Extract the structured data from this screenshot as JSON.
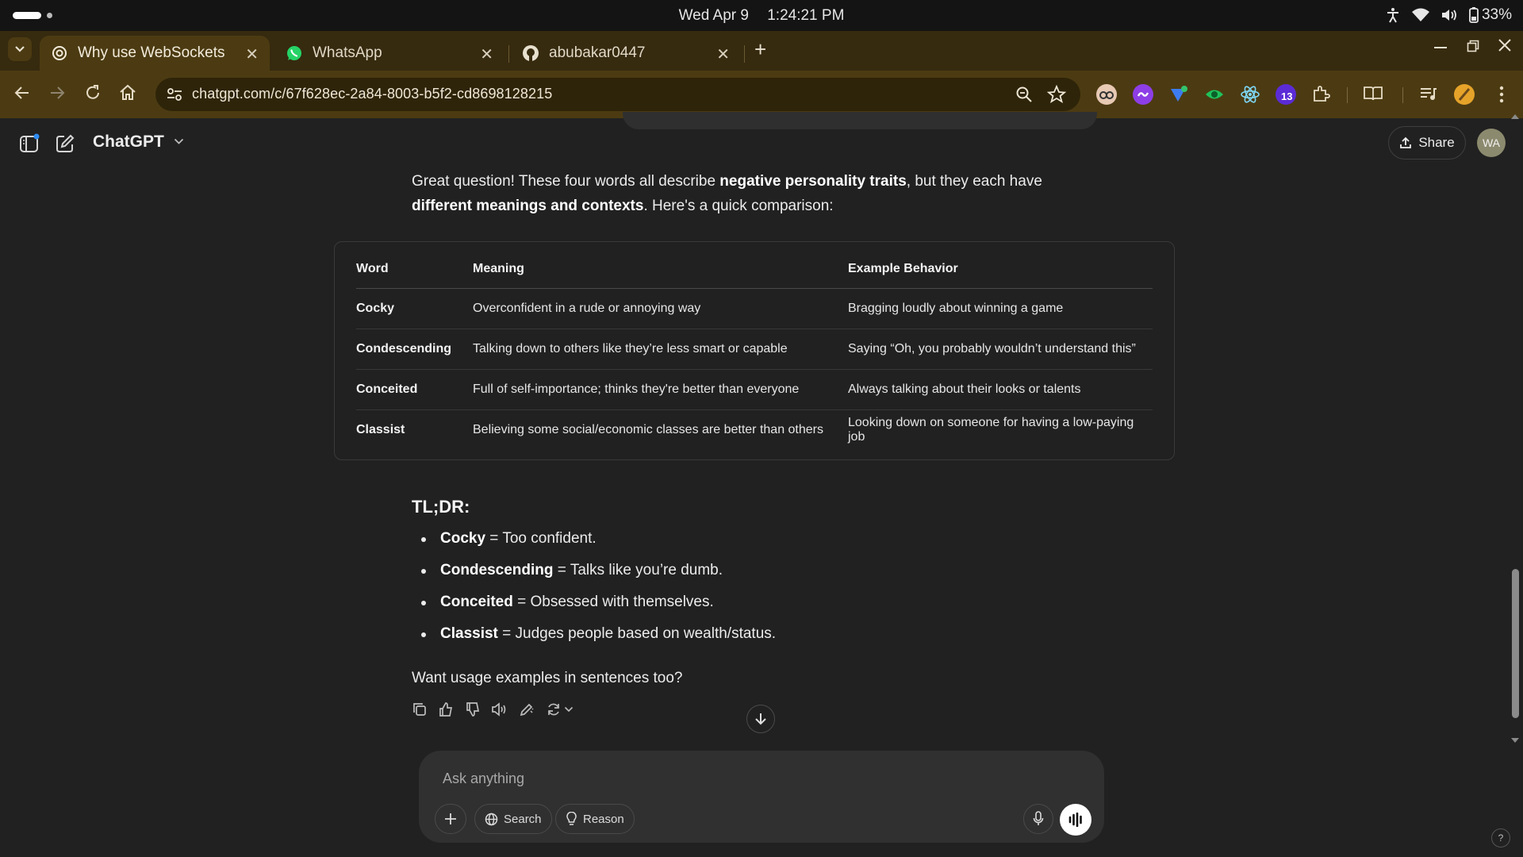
{
  "os": {
    "day": "Wed Apr 9",
    "time": "1:24:21 PM",
    "battery": "33%"
  },
  "tabs": [
    {
      "title": "Why use WebSockets",
      "icon": "chatgpt-icon"
    },
    {
      "title": "WhatsApp",
      "icon": "whatsapp-icon"
    },
    {
      "title": "abubakar0447",
      "icon": "github-icon"
    }
  ],
  "browser": {
    "url": "chatgpt.com/c/67f628ec-2a84-8003-b5f2-cd8698128215",
    "extension_badge": "13"
  },
  "app": {
    "name": "ChatGPT",
    "share_label": "Share",
    "avatar_initials": "WA"
  },
  "message": {
    "intro_1": "Great question! These four words all describe ",
    "intro_bold_1": "negative personality traits",
    "intro_2": ", but they each have ",
    "intro_bold_2": "different meanings and contexts",
    "intro_3": ". Here's a quick comparison:",
    "table": {
      "headers": [
        "Word",
        "Meaning",
        "Example Behavior"
      ],
      "rows": [
        [
          "Cocky",
          "Overconfident in a rude or annoying way",
          "Bragging loudly about winning a game"
        ],
        [
          "Condescending",
          "Talking down to others like they’re less smart or capable",
          "Saying “Oh, you probably wouldn’t understand this”"
        ],
        [
          "Conceited",
          "Full of self-importance; thinks they're better than everyone",
          "Always talking about their looks or talents"
        ],
        [
          "Classist",
          "Believing some social/economic classes are better than others",
          "Looking down on someone for having a low-paying job"
        ]
      ]
    },
    "tldr_heading": "TL;DR:",
    "tldr": [
      {
        "term": "Cocky",
        "text": " = Too confident."
      },
      {
        "term": "Condescending",
        "text": " = Talks like you’re dumb."
      },
      {
        "term": "Conceited",
        "text": " = Obsessed with themselves."
      },
      {
        "term": "Classist",
        "text": " = Judges people based on wealth/status."
      }
    ],
    "closing": "Want usage examples in sentences too?"
  },
  "composer": {
    "placeholder": "Ask anything",
    "search_label": "Search",
    "reason_label": "Reason"
  },
  "help_label": "?"
}
